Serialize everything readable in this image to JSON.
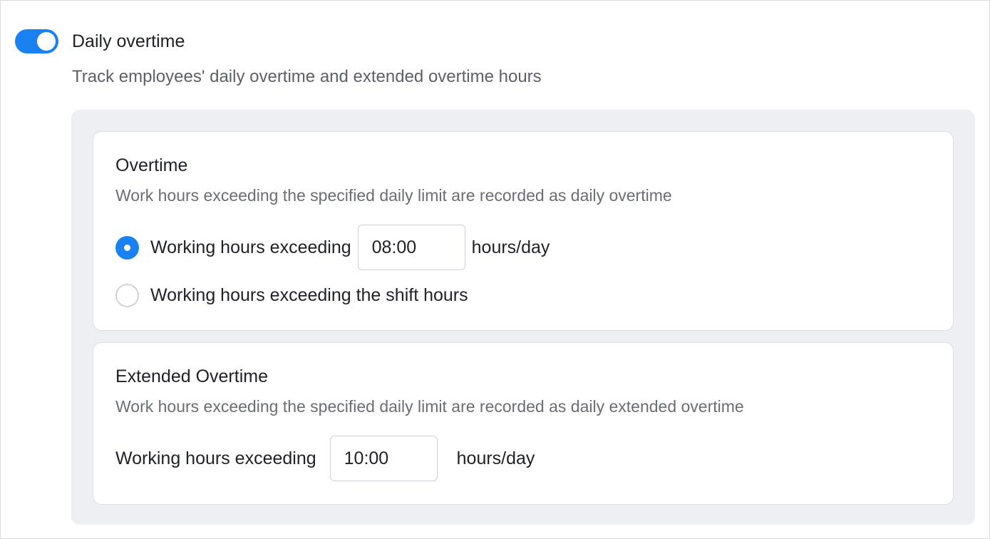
{
  "header": {
    "toggle_on": true,
    "title": "Daily overtime",
    "description": "Track employees' daily overtime and extended overtime hours"
  },
  "overtime": {
    "title": "Overtime",
    "description": "Work hours exceeding the specified daily limit are recorded as daily overtime",
    "option_fixed_label": "Working hours exceeding",
    "option_fixed_value": "08:00",
    "option_fixed_unit": "hours/day",
    "option_fixed_selected": true,
    "option_shift_label": "Working hours exceeding the shift hours",
    "option_shift_selected": false
  },
  "extended": {
    "title": "Extended Overtime",
    "description": "Work hours exceeding the specified daily limit are recorded as daily extended overtime",
    "label": "Working hours exceeding",
    "value": "10:00",
    "unit": "hours/day"
  },
  "colors": {
    "accent": "#1a82f0",
    "panel_bg": "#eeeff2",
    "border": "#dcdee3"
  }
}
